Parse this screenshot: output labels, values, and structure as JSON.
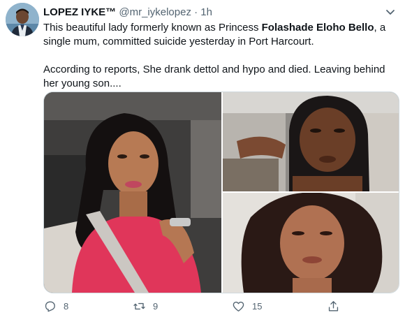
{
  "tweet": {
    "display_name": "LOPEZ IYKE™",
    "handle": "@mr_iykelopez",
    "separator": "·",
    "time": "1h",
    "text_intro": "This beautiful lady formerly known as Princess ",
    "text_bold_name": "Folashade Eloho Bello",
    "text_rest": ", a single mum, committed suicide yesterday in Port Harcourt.",
    "text_paragraph2": "According to reports, She drank dettol and hypo and died. Leaving behind her young son...."
  },
  "actions": {
    "reply_count": "8",
    "retweet_count": "9",
    "like_count": "15"
  },
  "icons": {
    "caret": "chevron-down-icon",
    "reply": "reply-icon",
    "retweet": "retweet-icon",
    "like": "heart-icon",
    "share": "share-icon"
  },
  "colors": {
    "text_primary": "#0f1419",
    "text_secondary": "#536471",
    "border": "#cfd9de"
  }
}
